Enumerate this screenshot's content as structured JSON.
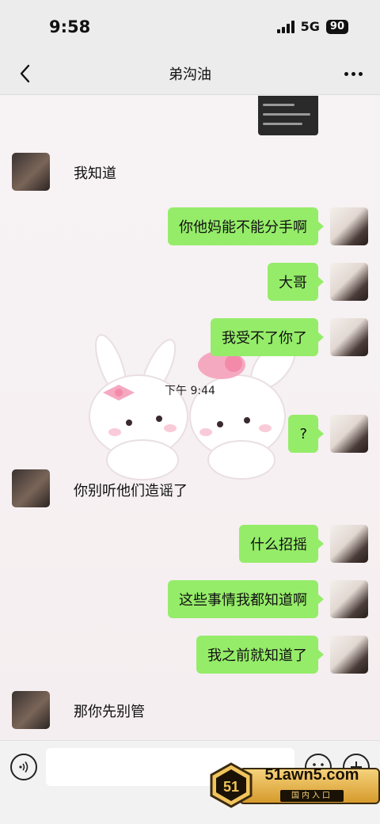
{
  "status_bar": {
    "time": "9:58",
    "network": "5G",
    "battery": "90",
    "icons": [
      "signal-icon",
      "battery-icon"
    ]
  },
  "nav": {
    "title": "弟沟油",
    "back_icon": "chevron-left-icon",
    "more_icon": "more-dots-icon"
  },
  "messages": [
    {
      "sender": "other",
      "text": "我知道"
    },
    {
      "sender": "me",
      "text": "你他妈能不能分手啊"
    },
    {
      "sender": "me",
      "text": "大哥"
    },
    {
      "sender": "me",
      "text": "我受不了你了"
    },
    {
      "sender": "system",
      "text": "下午 9:44"
    },
    {
      "sender": "me",
      "text": "?"
    },
    {
      "sender": "other",
      "text": "你别听他们造谣了"
    },
    {
      "sender": "me",
      "text": "什么招摇"
    },
    {
      "sender": "me",
      "text": "这些事情我都知道啊"
    },
    {
      "sender": "me",
      "text": "我之前就知道了"
    },
    {
      "sender": "other",
      "text": "那你先别管"
    }
  ],
  "input_bar": {
    "placeholder": "",
    "icons": [
      "voice-icon",
      "emoji-icon",
      "plus-icon"
    ]
  },
  "watermark": {
    "badge": "51",
    "text": "51awn5.com",
    "subtext": "国内入口"
  },
  "colors": {
    "bubble_me": "#95ec69",
    "background": "#f6f0f2",
    "nav_background": "#ececec"
  }
}
